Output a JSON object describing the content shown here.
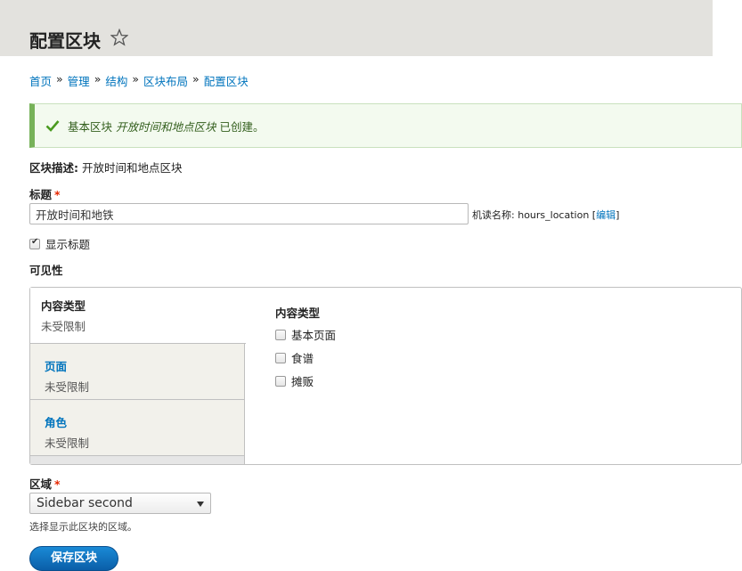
{
  "header": {
    "title": "配置区块"
  },
  "breadcrumb": [
    "首页",
    "管理",
    "结构",
    "区块布局",
    "配置区块"
  ],
  "breadcrumb_sep": "»",
  "status": {
    "prefix": "基本区块",
    "block_name": "开放时间和地点区块",
    "suffix": "已创建。"
  },
  "description": {
    "label": "区块描述:",
    "value": "开放时间和地点区块"
  },
  "title_field": {
    "label": "标题",
    "required_mark": "*",
    "value": "开放时间和地铁",
    "machine_label": "机读名称:",
    "machine_value": "hours_location",
    "edit_link": "编辑"
  },
  "show_title": {
    "label": "显示标题",
    "checked": true
  },
  "visibility": {
    "heading": "可见性",
    "tabs": [
      {
        "title": "内容类型",
        "summary": "未受限制"
      },
      {
        "title": "页面",
        "summary": "未受限制"
      },
      {
        "title": "角色",
        "summary": "未受限制"
      }
    ],
    "pane": {
      "title": "内容类型",
      "options": [
        "基本页面",
        "食谱",
        "摊贩"
      ]
    }
  },
  "region": {
    "label": "区域",
    "required_mark": "*",
    "selected": "Sidebar second",
    "help": "选择显示此区块的区域。"
  },
  "actions": {
    "save_label": "保存区块"
  },
  "colors": {
    "link": "#0074bd",
    "required": "#e62600",
    "status_border": "#77b259",
    "button": "#0a5ea8"
  }
}
